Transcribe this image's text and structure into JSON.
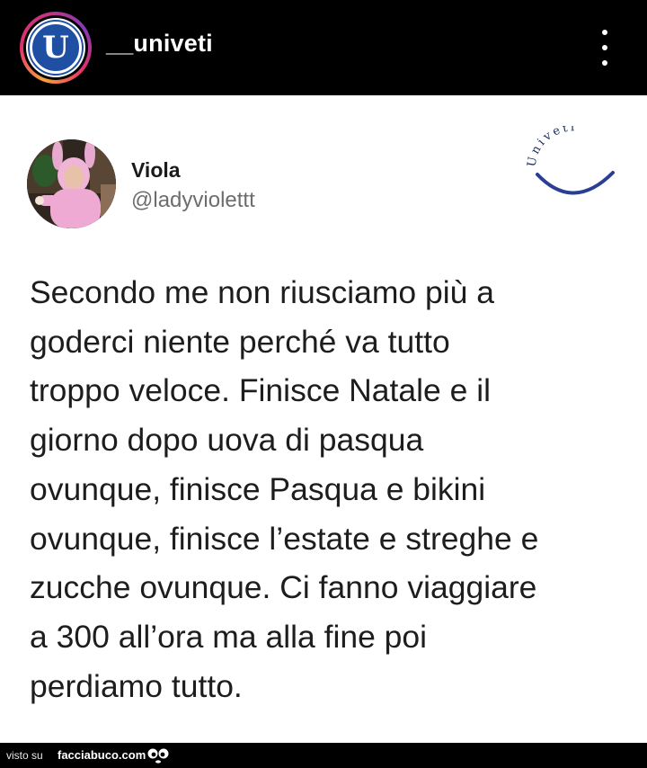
{
  "post_header": {
    "username": "__univeti",
    "avatar_letter": "U",
    "avatar_icon": "univeti-logo-icon",
    "more_icon": "more-vertical-icon"
  },
  "tweet": {
    "display_name": "Viola",
    "handle": "@ladyviolettt",
    "text": "Secondo me non riusciamo più a\ngoderci niente perché va tutto\ntroppo veloce. Finisce Natale e il\ngiorno dopo uova di pasqua\novunque, finisce Pasqua e bikini\novunque, finisce l’estate e streghe e\nzucche ovunque. Ci fanno viaggiare\na 300 all’ora ma alla fine poi\nperdiamo tutto.",
    "watermark_logo_text": "Univeti"
  },
  "footer": {
    "visto_label": "visto su",
    "site_label": "facciabuco.com"
  },
  "colors": {
    "header_bg": "#000000",
    "logo_blue": "#1f4fa3",
    "text": "#1d1d1d",
    "handle": "#6d6d6d"
  }
}
